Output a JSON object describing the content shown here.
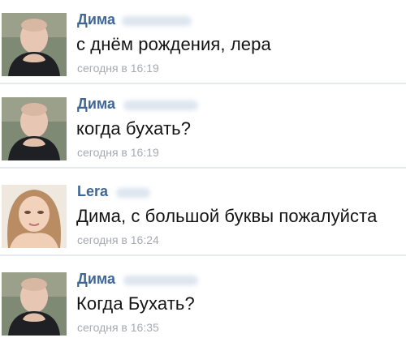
{
  "messages": [
    {
      "author": "Дима",
      "text": "с днём рождения, лера",
      "time": "сегодня в 16:19",
      "avatar": "avatar-man"
    },
    {
      "author": "Дима",
      "text": "когда бухать?",
      "time": "сегодня в 16:19",
      "avatar": "avatar-man"
    },
    {
      "author": "Lera",
      "text": "Дима, с большой буквы пожалуйста",
      "time": "сегодня в 16:24",
      "avatar": "avatar-woman"
    },
    {
      "author": "Дима",
      "text": "Когда Бухать?",
      "time": "сегодня в 16:35",
      "avatar": "avatar-man"
    }
  ],
  "colors": {
    "author": "#3f6796",
    "text": "#141414",
    "time": "#a6aab0",
    "divider": "#e6e9ee"
  }
}
